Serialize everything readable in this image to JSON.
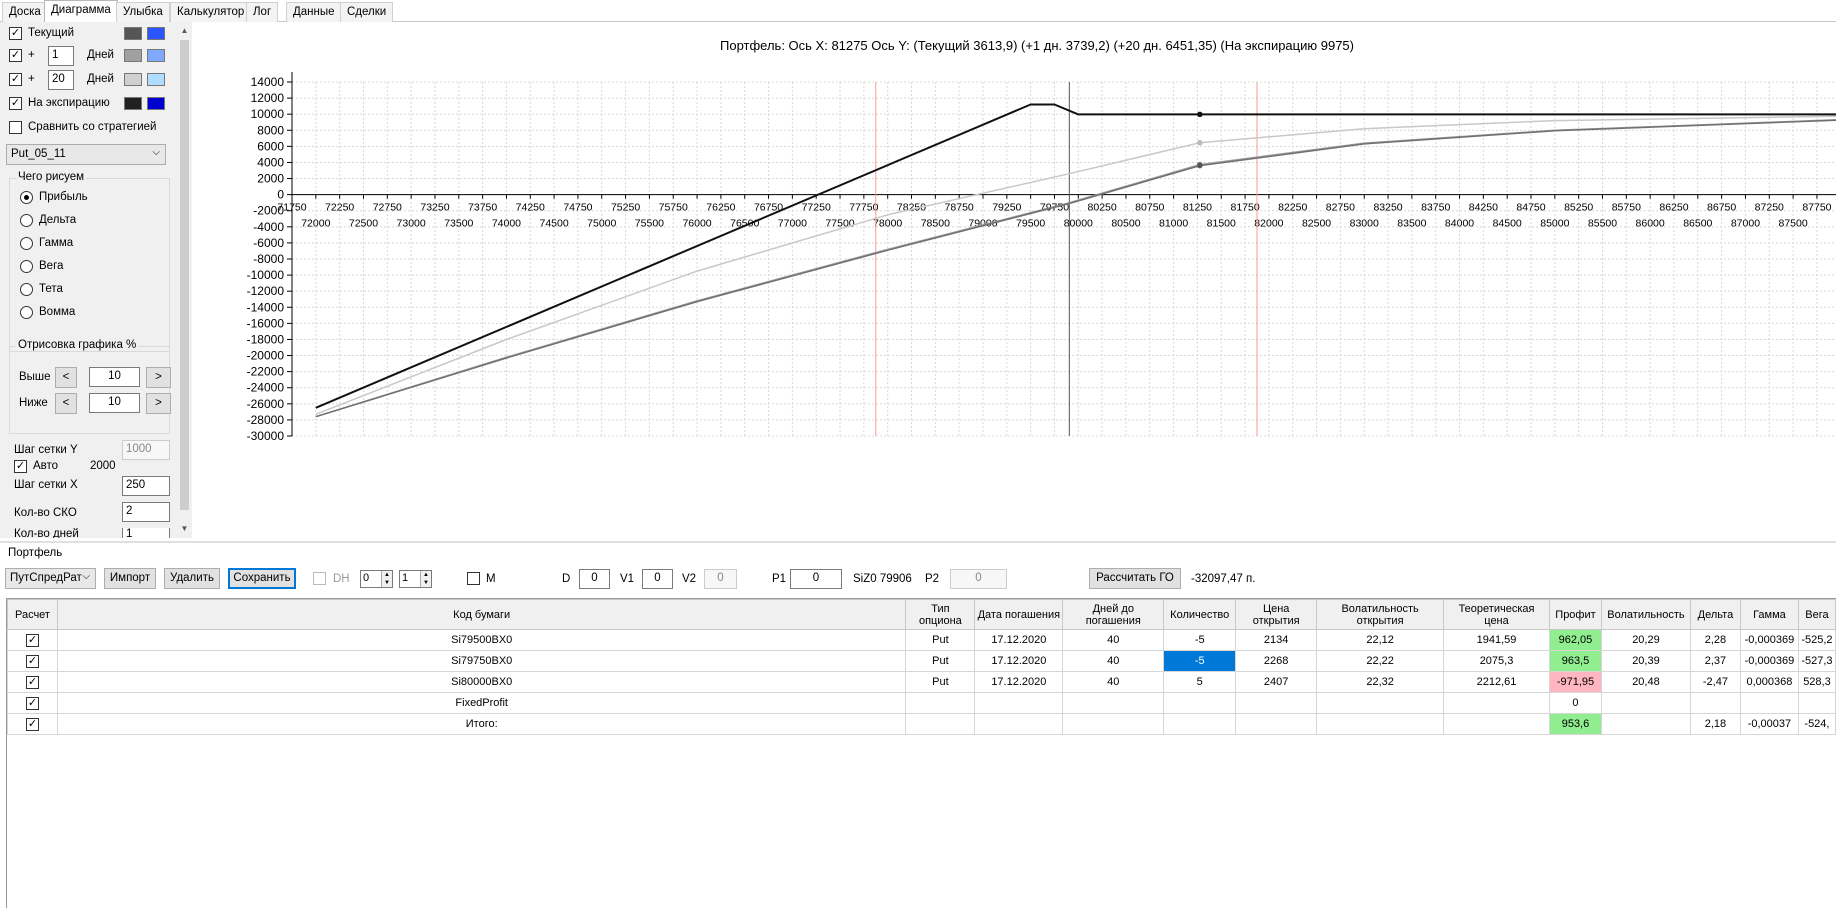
{
  "tabs": [
    "Доска",
    "Диаграмма",
    "Улыбка",
    "Калькулятор",
    "Лог",
    "Данные",
    "Сделки"
  ],
  "left": {
    "current_label": "Текущий",
    "plus": "+",
    "days_label": "Дней",
    "days1": "1",
    "days2": "20",
    "expiry_label": "На экспирацию",
    "compare_label": "Сравнить со стратегией",
    "strategy": "Put_05_11",
    "draw_group": "Чего рисуем",
    "draw_options": [
      "Прибыль",
      "Дельта",
      "Гамма",
      "Вега",
      "Тета",
      "Вомма"
    ],
    "render_group": "Отрисовка графика %",
    "above_label": "Выше",
    "below_label": "Ниже",
    "above_value": "10",
    "below_value": "10",
    "grid_y_label": "Шаг сетки Y",
    "grid_y_value": "1000",
    "auto_label": "Авто",
    "auto_value": "2000",
    "grid_x_label": "Шаг сетки X",
    "grid_x_value": "250",
    "sko_label": "Кол-во СКО",
    "sko_value": "2",
    "days_count_label": "Кол-во дней",
    "days_count_value": "1",
    "colors": {
      "current": [
        "#555555",
        "#2a55ff"
      ],
      "day1": [
        "#a0a0a0",
        "#7fa8ff"
      ],
      "day20": [
        "#d0d0d0",
        "#b0ddff"
      ],
      "expiry": [
        "#202020",
        "#0000d0"
      ]
    }
  },
  "chart_data": {
    "type": "line",
    "title": "Портфель: Ось X: 81275 Ось Y:  (Текущий 3613,9)  (+1 дн. 3739,2)  (+20 дн. 6451,35)  (На экспирацию 9975)",
    "x_ticks_top": [
      "71750",
      "72250",
      "72750",
      "73250",
      "73750",
      "74250",
      "74750",
      "75250",
      "75750",
      "76250",
      "76750",
      "77250",
      "77750",
      "78250",
      "78750",
      "79250",
      "79750",
      "80250",
      "80750",
      "81250",
      "81750",
      "82250",
      "82750",
      "83250",
      "83750",
      "84250",
      "84750",
      "85250",
      "85750",
      "86250",
      "86750",
      "87250",
      "87750"
    ],
    "x_ticks_bottom": [
      "72000",
      "72500",
      "73000",
      "73500",
      "74000",
      "74500",
      "75000",
      "75500",
      "76000",
      "76500",
      "77000",
      "77500",
      "78000",
      "78500",
      "79000",
      "79500",
      "80000",
      "80500",
      "81000",
      "81500",
      "82000",
      "82500",
      "83000",
      "83500",
      "84000",
      "84500",
      "85000",
      "85500",
      "86000",
      "86500",
      "87000",
      "87500"
    ],
    "y_ticks": [
      "14000",
      "12000",
      "10000",
      "8000",
      "6000",
      "4000",
      "2000",
      "0",
      "-2000",
      "-4000",
      "-6000",
      "-8000",
      "-10000",
      "-12000",
      "-14000",
      "-16000",
      "-18000",
      "-20000",
      "-22000",
      "-24000",
      "-26000",
      "-28000",
      "-30000"
    ],
    "xlim": [
      71750,
      87950
    ],
    "ylim": [
      -30000,
      14000
    ],
    "markers": {
      "red_lines": [
        77875,
        81875
      ],
      "current_price": 79906,
      "cursor_x": 81275
    },
    "series": [
      {
        "color": "#111111",
        "points": [
          [
            72000,
            -26500
          ],
          [
            79500,
            11200
          ],
          [
            79750,
            11200
          ],
          [
            80000,
            9975
          ],
          [
            87950,
            9975
          ]
        ]
      },
      {
        "color": "#c8c8c8",
        "points": [
          [
            72000,
            -27300
          ],
          [
            74000,
            -18000
          ],
          [
            76000,
            -9500
          ],
          [
            78000,
            -2500
          ],
          [
            79906,
            2600
          ],
          [
            81275,
            6451
          ],
          [
            83000,
            8200
          ],
          [
            85000,
            9200
          ],
          [
            87950,
            9750
          ]
        ]
      },
      {
        "color": "#a0a0a0",
        "points": [
          [
            72000,
            -27600
          ],
          [
            74000,
            -20200
          ],
          [
            76000,
            -13200
          ],
          [
            78000,
            -6800
          ],
          [
            79906,
            -1000
          ],
          [
            81275,
            3739
          ],
          [
            83000,
            6400
          ],
          [
            85000,
            8000
          ],
          [
            87950,
            9300
          ]
        ]
      },
      {
        "color": "#707070",
        "points": [
          [
            72000,
            -27600
          ],
          [
            74000,
            -20300
          ],
          [
            76000,
            -13300
          ],
          [
            78000,
            -6900
          ],
          [
            79906,
            -1100
          ],
          [
            81275,
            3614
          ],
          [
            83000,
            6300
          ],
          [
            85000,
            7950
          ],
          [
            87950,
            9250
          ]
        ]
      }
    ]
  },
  "portfolio": {
    "label": "Портфель",
    "select": "ПутСпредРат",
    "import": "Импорт",
    "delete": "Удалить",
    "save": "Сохранить",
    "dh": "DH",
    "spin1": "0",
    "spin2": "1",
    "m": "M",
    "d_label": "D",
    "d_value": "0",
    "v1_label": "V1",
    "v1_value": "0",
    "v2_label": "V2",
    "v2_value": "0",
    "p1_label": "P1",
    "p1_value": "0",
    "siz": "SiZ0 79906",
    "p2_label": "P2",
    "p2_value": "0",
    "calc_go": "Рассчитать ГО",
    "go_value": "-32097,47 п."
  },
  "table": {
    "headers": [
      "Расчет",
      "Код бумаги",
      "Тип опциона",
      "Дата погашения",
      "Дней до погашения",
      "Количество",
      "Цена открытия",
      "Волатильность открытия",
      "Теоретическая цена",
      "Профит",
      "Волатильность",
      "Дельта",
      "Гамма",
      "Вега"
    ],
    "rows": [
      [
        "",
        "Si79500BX0",
        "Put",
        "17.12.2020",
        "40",
        "-5",
        "2134",
        "22,12",
        "1941,59",
        "962,05",
        "20,29",
        "2,28",
        "-0,000369",
        "-525,2"
      ],
      [
        "",
        "Si79750BX0",
        "Put",
        "17.12.2020",
        "40",
        "-5",
        "2268",
        "22,22",
        "2075,3",
        "963,5",
        "20,39",
        "2,37",
        "-0,000369",
        "-527,3"
      ],
      [
        "",
        "Si80000BX0",
        "Put",
        "17.12.2020",
        "40",
        "5",
        "2407",
        "22,32",
        "2212,61",
        "-971,95",
        "20,48",
        "-2,47",
        "0,000368",
        "528,3"
      ],
      [
        "",
        "FixedProfit",
        "",
        "",
        "",
        "",
        "",
        "",
        "",
        "0",
        "",
        "",
        "",
        ""
      ],
      [
        "",
        "Итого:",
        "",
        "",
        "",
        "",
        "",
        "",
        "",
        "953,6",
        "",
        "2,18",
        "-0,00037",
        "-524,"
      ]
    ]
  }
}
